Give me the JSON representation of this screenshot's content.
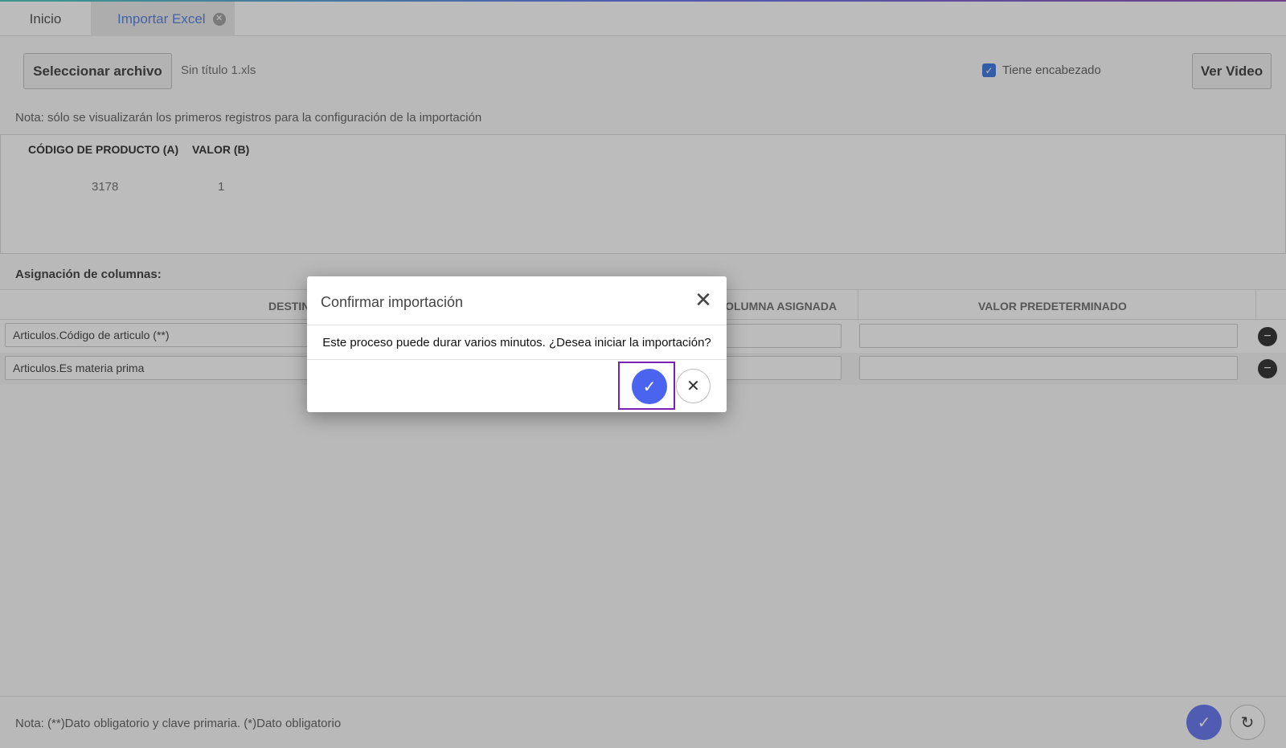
{
  "tabs": [
    {
      "label": "Inicio"
    },
    {
      "label": "Importar Excel",
      "close_icon": "circle-x-icon"
    }
  ],
  "toolbar": {
    "select_file_label": "Seleccionar archivo",
    "file_name": "Sin título 1.xls",
    "has_header_label": "Tiene encabezado",
    "has_header_checked": true,
    "video_label": "Ver Video"
  },
  "note_top": "Nota: sólo se visualizarán los primeros registros para la configuración de la importación",
  "preview": {
    "headers": [
      "CÓDIGO DE PRODUCTO (A)",
      "VALOR (B)"
    ],
    "rows": [
      [
        "3178",
        "1"
      ]
    ]
  },
  "assignment": {
    "title": "Asignación de columnas:",
    "headers": {
      "destination": "DESTINO",
      "assigned_column": "COLUMNA ASIGNADA",
      "default_value": "VALOR PREDETERMINADO"
    },
    "rows": [
      {
        "destination": "Articulos.Código de articulo (**)",
        "assigned_column": "",
        "default_value": ""
      },
      {
        "destination": "Articulos.Es materia prima",
        "assigned_column": "",
        "default_value": ""
      }
    ]
  },
  "footer": {
    "note": "Nota: (**)Dato obligatorio y clave primaria. (*)Dato obligatorio"
  },
  "dialog": {
    "title": "Confirmar importación",
    "message": "Este proceso puede durar varios minutos. ¿Desea iniciar la importación?",
    "close_icon": "close-icon",
    "confirm_icon": "check-icon",
    "cancel_icon": "close-icon"
  },
  "colors": {
    "accent": "#5b6cf0",
    "tab_active_text": "#4a78d6",
    "checkbox": "#2f6fe0",
    "focus_frame": "#7a1fb8"
  }
}
